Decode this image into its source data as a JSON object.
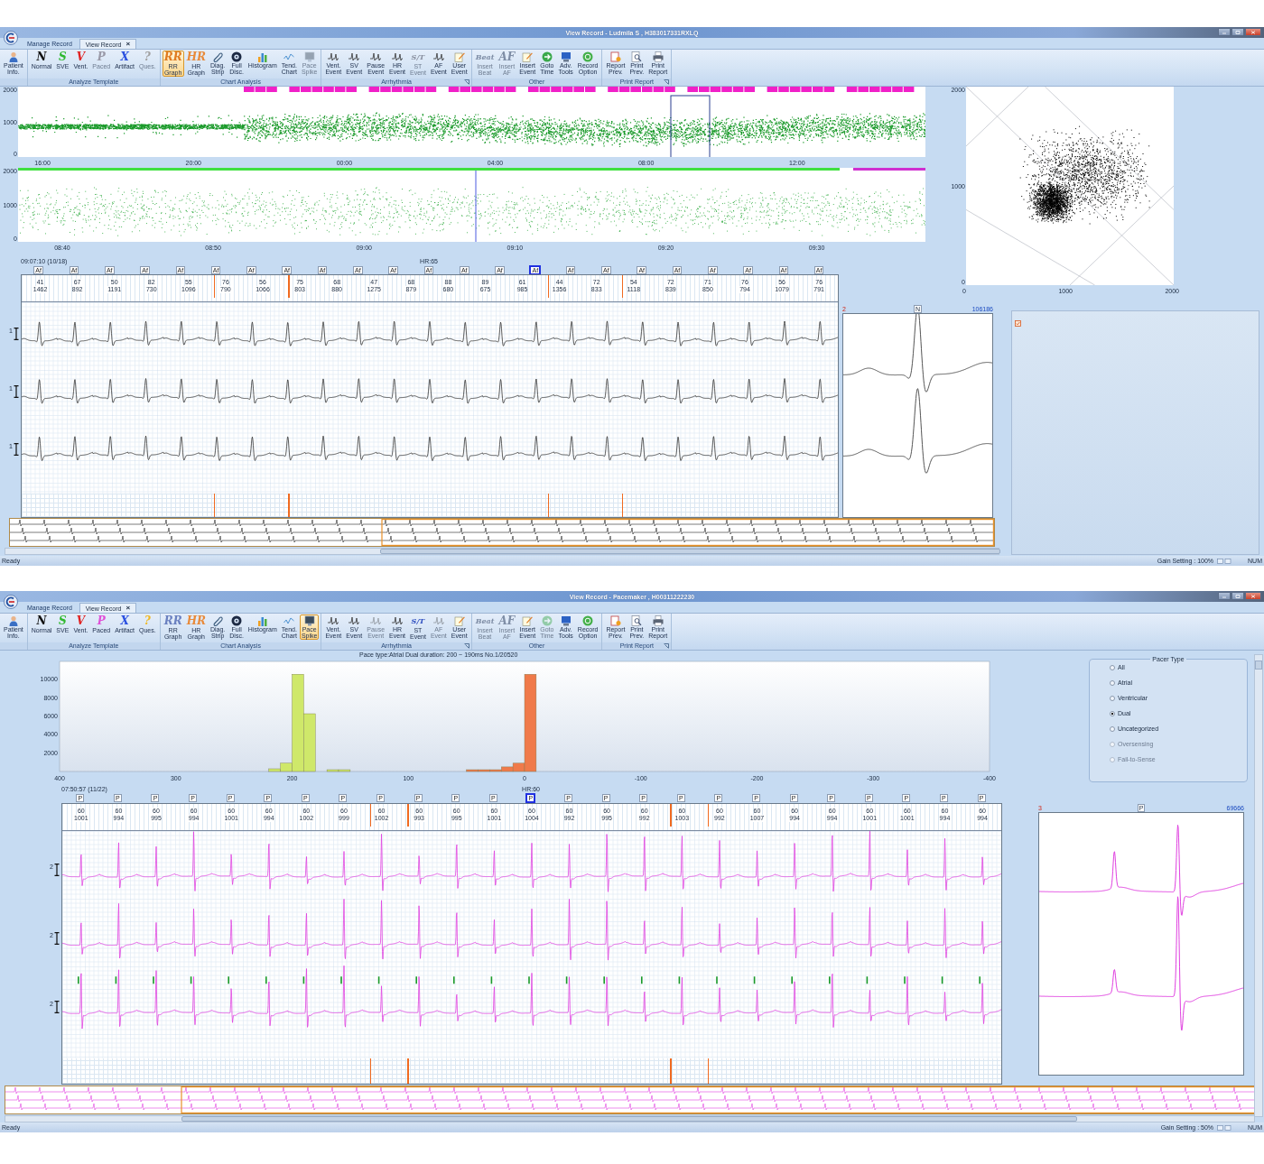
{
  "windows": [
    {
      "kind": "rr",
      "title": "View Record - Ludmila S , H383017331RXLQ",
      "tabs": [
        {
          "label": "Manage Record",
          "selected": false
        },
        {
          "label": "View Record",
          "selected": true,
          "close": "×"
        }
      ],
      "ribbon": [
        {
          "launcher": false,
          "buttons": [
            {
              "label": "Patient\nInfo.",
              "kind": "person",
              "selected": false,
              "disabled": false
            }
          ]
        },
        {
          "label": "Analyze Template",
          "launcher": false,
          "buttons": [
            {
              "label": "Normal",
              "kind": "glyph",
              "glyph": "N",
              "color": "#111111",
              "selected": false,
              "disabled": false
            },
            {
              "label": "SVE",
              "kind": "glyph",
              "glyph": "S",
              "color": "#2fb82f",
              "selected": false,
              "disabled": false
            },
            {
              "label": "Vent.",
              "kind": "glyph",
              "glyph": "V",
              "color": "#e02020",
              "selected": false,
              "disabled": false
            },
            {
              "label": "Paced",
              "kind": "glyph",
              "glyph": "P",
              "color": "#9a9aa8",
              "selected": false,
              "disabled": true
            },
            {
              "label": "Artifact",
              "kind": "glyph",
              "glyph": "X",
              "color": "#2a4fe0",
              "selected": false,
              "disabled": false
            },
            {
              "label": "Ques.",
              "kind": "glyph",
              "glyph": "?",
              "color": "#a0a0a0",
              "selected": false,
              "disabled": true
            }
          ]
        },
        {
          "label": "Chart Analysis",
          "launcher": false,
          "buttons": [
            {
              "label": "RR\nGraph",
              "kind": "glyph",
              "glyph": "RR",
              "color": "#e07a20",
              "selected": true,
              "disabled": false
            },
            {
              "label": "HR\nGraph",
              "kind": "glyph",
              "glyph": "HR",
              "color": "#e88a3a",
              "selected": false,
              "disabled": false
            },
            {
              "label": "Diag.\nStrip",
              "kind": "clip",
              "selected": false,
              "disabled": false
            },
            {
              "label": "Full\nDisc.",
              "kind": "disc",
              "selected": false,
              "disabled": false
            },
            {
              "label": "Histogram",
              "kind": "bars",
              "selected": false,
              "disabled": false
            },
            {
              "label": "Tend.\nChart",
              "kind": "trend",
              "selected": false,
              "disabled": false
            },
            {
              "label": "Pace\nSpike",
              "kind": "screen",
              "selected": false,
              "disabled": true
            }
          ]
        },
        {
          "label": "Arrhythmia",
          "launcher": true,
          "buttons": [
            {
              "label": "Vent.\nEvent",
              "kind": "wave",
              "selected": false,
              "disabled": false
            },
            {
              "label": "SV\nEvent",
              "kind": "wave",
              "selected": false,
              "disabled": false
            },
            {
              "label": "Pause\nEvent",
              "kind": "wave",
              "selected": false,
              "disabled": false
            },
            {
              "label": "HR\nEvent",
              "kind": "wave",
              "selected": false,
              "disabled": false
            },
            {
              "label": "ST\nEvent",
              "kind": "glyph",
              "glyph": "S/T",
              "color": "#8a90a0",
              "selected": false,
              "disabled": true
            },
            {
              "label": "AF\nEvent",
              "kind": "wave",
              "selected": false,
              "disabled": false
            },
            {
              "label": "User\nEvent",
              "kind": "note",
              "selected": false,
              "disabled": false
            }
          ]
        },
        {
          "label": "Other",
          "launcher": false,
          "buttons": [
            {
              "label": "Insert\nBeat",
              "kind": "glyph",
              "glyph": "Beat",
              "color": "#7f8ea6",
              "selected": false,
              "disabled": true
            },
            {
              "label": "Insert\nAF",
              "kind": "glyph",
              "glyph": "AF",
              "color": "#7f8ea6",
              "selected": false,
              "disabled": true
            },
            {
              "label": "Insert\nEvent",
              "kind": "note",
              "selected": false,
              "disabled": false
            },
            {
              "label": "Goto\nTime",
              "kind": "go",
              "selected": false,
              "disabled": false
            },
            {
              "label": "Adv.\nTools",
              "kind": "computer",
              "selected": false,
              "disabled": false
            },
            {
              "label": "Record\nOption",
              "kind": "record",
              "selected": false,
              "disabled": false
            }
          ]
        },
        {
          "label": "Print Report",
          "launcher": true,
          "buttons": [
            {
              "label": "Report\nPrev.",
              "kind": "report",
              "selected": false,
              "disabled": false
            },
            {
              "label": "Print\nPrev.",
              "kind": "preview",
              "selected": false,
              "disabled": false
            },
            {
              "label": "Print\nReport",
              "kind": "printer",
              "selected": false,
              "disabled": false
            }
          ]
        }
      ],
      "trend_charts": [
        {
          "kind": "day",
          "y_ticks": [
            "2000",
            "1000",
            "0"
          ],
          "x_ticks": [
            "16:00",
            "20:00",
            "00:00",
            "04:00",
            "08:00",
            "12:00"
          ]
        },
        {
          "kind": "detail",
          "y_ticks": [
            "2000",
            "1000",
            "0"
          ],
          "x_ticks": [
            "08:40",
            "08:50",
            "09:00",
            "09:10",
            "09:20",
            "09:30"
          ]
        }
      ],
      "scatter_plot": {
        "y_ticks": [
          "2000",
          "1000",
          "0"
        ],
        "x_ticks": [
          "0",
          "1000",
          "2000"
        ]
      },
      "ecg": {
        "timestamp": "09:07:10 (10/18)",
        "heart_rate": "HR:65",
        "beat_markers": [
          {
            "label": "Af",
            "selected": false
          },
          {
            "label": "Af",
            "selected": false
          },
          {
            "label": "Af",
            "selected": false
          },
          {
            "label": "Af",
            "selected": false
          },
          {
            "label": "Af",
            "selected": false
          },
          {
            "label": "Af",
            "selected": false
          },
          {
            "label": "Af",
            "selected": false
          },
          {
            "label": "Af",
            "selected": false
          },
          {
            "label": "Af",
            "selected": false
          },
          {
            "label": "Af",
            "selected": false
          },
          {
            "label": "Af",
            "selected": false
          },
          {
            "label": "Af",
            "selected": false
          },
          {
            "label": "Af",
            "selected": false
          },
          {
            "label": "Af",
            "selected": false
          },
          {
            "label": "Af",
            "selected": true
          },
          {
            "label": "Af",
            "selected": false
          },
          {
            "label": "Af",
            "selected": false
          },
          {
            "label": "Af",
            "selected": false
          },
          {
            "label": "Af",
            "selected": false
          },
          {
            "label": "Af",
            "selected": false
          },
          {
            "label": "Af",
            "selected": false
          },
          {
            "label": "Af",
            "selected": false
          },
          {
            "label": "Af",
            "selected": false
          }
        ],
        "intervals": [
          {
            "hr": "41",
            "rr": "1462",
            "marked": false
          },
          {
            "hr": "67",
            "rr": "892",
            "marked": false
          },
          {
            "hr": "50",
            "rr": "1191",
            "marked": false
          },
          {
            "hr": "82",
            "rr": "730",
            "marked": false
          },
          {
            "hr": "55",
            "rr": "1096",
            "marked": false
          },
          {
            "hr": "76",
            "rr": "790",
            "marked": true
          },
          {
            "hr": "56",
            "rr": "1066",
            "marked": false
          },
          {
            "hr": "75",
            "rr": "803",
            "marked": true
          },
          {
            "hr": "68",
            "rr": "880",
            "marked": false
          },
          {
            "hr": "47",
            "rr": "1275",
            "marked": false
          },
          {
            "hr": "68",
            "rr": "879",
            "marked": false
          },
          {
            "hr": "88",
            "rr": "680",
            "marked": false
          },
          {
            "hr": "89",
            "rr": "675",
            "marked": false
          },
          {
            "hr": "61",
            "rr": "985",
            "marked": false
          },
          {
            "hr": "44",
            "rr": "1356",
            "marked": true
          },
          {
            "hr": "72",
            "rr": "833",
            "marked": false
          },
          {
            "hr": "54",
            "rr": "1118",
            "marked": true
          },
          {
            "hr": "72",
            "rr": "839",
            "marked": false
          },
          {
            "hr": "71",
            "rr": "850",
            "marked": false
          },
          {
            "hr": "76",
            "rr": "794",
            "marked": false
          },
          {
            "hr": "56",
            "rr": "1079",
            "marked": false
          },
          {
            "hr": "76",
            "rr": "791",
            "marked": false
          }
        ],
        "channels": [
          {
            "label": "1"
          },
          {
            "label": "1"
          },
          {
            "label": "1"
          }
        ]
      },
      "template": {
        "number": "2",
        "beat_type": "N",
        "count": "106186"
      },
      "status_bar": {
        "text": "Ready",
        "gain": "Gain Setting : 100%",
        "mode": "NUM"
      }
    },
    {
      "kind": "pace",
      "title": "View Record - Pacemaker , H00311222230",
      "tabs": [
        {
          "label": "Manage Record",
          "selected": false
        },
        {
          "label": "View Record",
          "selected": true,
          "close": "×"
        }
      ],
      "ribbon": [
        {
          "launcher": false,
          "buttons": [
            {
              "label": "Patient\nInfo.",
              "kind": "person",
              "selected": false,
              "disabled": false
            }
          ]
        },
        {
          "label": "Analyze Template",
          "launcher": false,
          "buttons": [
            {
              "label": "Normal",
              "kind": "glyph",
              "glyph": "N",
              "color": "#111111",
              "selected": false,
              "disabled": false
            },
            {
              "label": "SVE",
              "kind": "glyph",
              "glyph": "S",
              "color": "#2fb82f",
              "selected": false,
              "disabled": false
            },
            {
              "label": "Vent.",
              "kind": "glyph",
              "glyph": "V",
              "color": "#e02020",
              "selected": false,
              "disabled": false
            },
            {
              "label": "Paced",
              "kind": "glyph",
              "glyph": "P",
              "color": "#e050d8",
              "selected": false,
              "disabled": false
            },
            {
              "label": "Artifact",
              "kind": "glyph",
              "glyph": "X",
              "color": "#2a4fe0",
              "selected": false,
              "disabled": false
            },
            {
              "label": "Ques.",
              "kind": "glyph",
              "glyph": "?",
              "color": "#f0b820",
              "selected": false,
              "disabled": false
            }
          ]
        },
        {
          "label": "Chart Analysis",
          "launcher": false,
          "buttons": [
            {
              "label": "RR\nGraph",
              "kind": "glyph",
              "glyph": "RR",
              "color": "#6a80c0",
              "selected": false,
              "disabled": false
            },
            {
              "label": "HR\nGraph",
              "kind": "glyph",
              "glyph": "HR",
              "color": "#e88a3a",
              "selected": false,
              "disabled": false
            },
            {
              "label": "Diag.\nStrip",
              "kind": "clip",
              "selected": false,
              "disabled": false
            },
            {
              "label": "Full\nDisc.",
              "kind": "disc",
              "selected": false,
              "disabled": false
            },
            {
              "label": "Histogram",
              "kind": "bars",
              "selected": false,
              "disabled": false
            },
            {
              "label": "Tend.\nChart",
              "kind": "trend",
              "selected": false,
              "disabled": false
            },
            {
              "label": "Pace\nSpike",
              "kind": "screen",
              "selected": true,
              "disabled": false
            }
          ]
        },
        {
          "label": "Arrhythmia",
          "launcher": true,
          "buttons": [
            {
              "label": "Vent.\nEvent",
              "kind": "wave",
              "selected": false,
              "disabled": false
            },
            {
              "label": "SV\nEvent",
              "kind": "wave",
              "selected": false,
              "disabled": false
            },
            {
              "label": "Pause\nEvent",
              "kind": "wave",
              "selected": false,
              "disabled": true
            },
            {
              "label": "HR\nEvent",
              "kind": "wave",
              "selected": false,
              "disabled": false
            },
            {
              "label": "ST\nEvent",
              "kind": "glyph",
              "glyph": "S/T",
              "color": "#3050c0",
              "selected": false,
              "disabled": false
            },
            {
              "label": "AF\nEvent",
              "kind": "wave",
              "selected": false,
              "disabled": true
            },
            {
              "label": "User\nEvent",
              "kind": "note",
              "selected": false,
              "disabled": false
            }
          ]
        },
        {
          "label": "Other",
          "launcher": false,
          "buttons": [
            {
              "label": "Insert\nBeat",
              "kind": "glyph",
              "glyph": "Beat",
              "color": "#7f8ea6",
              "selected": false,
              "disabled": true
            },
            {
              "label": "Insert\nAF",
              "kind": "glyph",
              "glyph": "AF",
              "color": "#7f8ea6",
              "selected": false,
              "disabled": true
            },
            {
              "label": "Insert\nEvent",
              "kind": "note",
              "selected": false,
              "disabled": false
            },
            {
              "label": "Goto\nTime",
              "kind": "go",
              "selected": false,
              "disabled": true
            },
            {
              "label": "Adv.\nTools",
              "kind": "computer",
              "selected": false,
              "disabled": false
            },
            {
              "label": "Record\nOption",
              "kind": "record",
              "selected": false,
              "disabled": false
            }
          ]
        },
        {
          "label": "Print Report",
          "launcher": true,
          "buttons": [
            {
              "label": "Report\nPrev.",
              "kind": "report",
              "selected": false,
              "disabled": false
            },
            {
              "label": "Print\nPrev.",
              "kind": "preview",
              "selected": false,
              "disabled": false
            },
            {
              "label": "Print\nReport",
              "kind": "printer",
              "selected": false,
              "disabled": false
            }
          ]
        }
      ],
      "histogram": {
        "chart_data": {
          "type": "bar",
          "title": "Pace type:Atrial Dual duration: 200 ~ 190ms No.1/20520",
          "x": [
            215,
            205,
            195,
            185,
            165,
            155,
            45,
            35,
            25,
            15,
            5,
            -5
          ],
          "series": [
            {
              "color": "#cfe86a",
              "values": [
                300,
                900,
                10600,
                6300,
                200,
                200,
                null,
                null,
                null,
                null,
                null,
                null
              ]
            },
            {
              "color": "#f07a4a",
              "values": [
                null,
                null,
                null,
                null,
                null,
                null,
                200,
                200,
                200,
                500,
                900,
                10600
              ]
            }
          ],
          "xlim": [
            400,
            -400
          ],
          "ylim": [
            0,
            12000
          ],
          "xticks": [
            400,
            300,
            200,
            100,
            0,
            -100,
            -200,
            -300,
            -400
          ],
          "yticks": [
            2000,
            4000,
            6000,
            8000,
            10000
          ]
        }
      },
      "pacer_panel": {
        "title": "Pacer Type",
        "options": [
          {
            "label": "All",
            "selected": false,
            "disabled": false
          },
          {
            "label": "Atrial",
            "selected": false,
            "disabled": false
          },
          {
            "label": "Ventricular",
            "selected": false,
            "disabled": false
          },
          {
            "label": "Dual",
            "selected": true,
            "disabled": false
          },
          {
            "label": "Uncategorized",
            "selected": false,
            "disabled": false
          },
          {
            "label": "Oversensing",
            "selected": false,
            "disabled": true
          },
          {
            "label": "Fail-to-Sense",
            "selected": false,
            "disabled": true
          }
        ]
      },
      "ecg": {
        "timestamp": "07:50:57 (11/22)",
        "heart_rate": "HR:60",
        "beat_markers": [
          {
            "label": "P",
            "selected": false
          },
          {
            "label": "P",
            "selected": false
          },
          {
            "label": "P",
            "selected": false
          },
          {
            "label": "P",
            "selected": false
          },
          {
            "label": "P",
            "selected": false
          },
          {
            "label": "P",
            "selected": false
          },
          {
            "label": "P",
            "selected": false
          },
          {
            "label": "P",
            "selected": false
          },
          {
            "label": "P",
            "selected": false
          },
          {
            "label": "P",
            "selected": false
          },
          {
            "label": "P",
            "selected": false
          },
          {
            "label": "P",
            "selected": false
          },
          {
            "label": "P",
            "selected": true
          },
          {
            "label": "P",
            "selected": false
          },
          {
            "label": "P",
            "selected": false
          },
          {
            "label": "P",
            "selected": false
          },
          {
            "label": "P",
            "selected": false
          },
          {
            "label": "P",
            "selected": false
          },
          {
            "label": "P",
            "selected": false
          },
          {
            "label": "P",
            "selected": false
          },
          {
            "label": "P",
            "selected": false
          },
          {
            "label": "P",
            "selected": false
          },
          {
            "label": "P",
            "selected": false
          },
          {
            "label": "P",
            "selected": false
          },
          {
            "label": "P",
            "selected": false
          }
        ],
        "intervals": [
          {
            "hr": "60",
            "rr": "1001",
            "marked": false
          },
          {
            "hr": "60",
            "rr": "994",
            "marked": false
          },
          {
            "hr": "60",
            "rr": "995",
            "marked": false
          },
          {
            "hr": "60",
            "rr": "994",
            "marked": false
          },
          {
            "hr": "60",
            "rr": "1001",
            "marked": false
          },
          {
            "hr": "60",
            "rr": "994",
            "marked": false
          },
          {
            "hr": "60",
            "rr": "1002",
            "marked": false
          },
          {
            "hr": "60",
            "rr": "999",
            "marked": false
          },
          {
            "hr": "60",
            "rr": "1002",
            "marked": true
          },
          {
            "hr": "60",
            "rr": "993",
            "marked": true
          },
          {
            "hr": "60",
            "rr": "995",
            "marked": false
          },
          {
            "hr": "60",
            "rr": "1001",
            "marked": false
          },
          {
            "hr": "60",
            "rr": "1004",
            "marked": false
          },
          {
            "hr": "60",
            "rr": "992",
            "marked": false
          },
          {
            "hr": "60",
            "rr": "995",
            "marked": false
          },
          {
            "hr": "60",
            "rr": "992",
            "marked": false
          },
          {
            "hr": "60",
            "rr": "1003",
            "marked": true
          },
          {
            "hr": "60",
            "rr": "992",
            "marked": true
          },
          {
            "hr": "60",
            "rr": "1007",
            "marked": false
          },
          {
            "hr": "60",
            "rr": "994",
            "marked": false
          },
          {
            "hr": "60",
            "rr": "994",
            "marked": false
          },
          {
            "hr": "60",
            "rr": "1001",
            "marked": false
          },
          {
            "hr": "60",
            "rr": "1001",
            "marked": false
          },
          {
            "hr": "60",
            "rr": "994",
            "marked": false
          },
          {
            "hr": "60",
            "rr": "994",
            "marked": false
          }
        ],
        "channels": [
          {
            "label": "2"
          },
          {
            "label": "2"
          },
          {
            "label": "2"
          }
        ]
      },
      "template": {
        "number": "3",
        "beat_type": "P",
        "count": "69666"
      },
      "status_bar": {
        "text": "Ready",
        "gain": "Gain Setting : 50%",
        "mode": "NUM"
      }
    }
  ]
}
